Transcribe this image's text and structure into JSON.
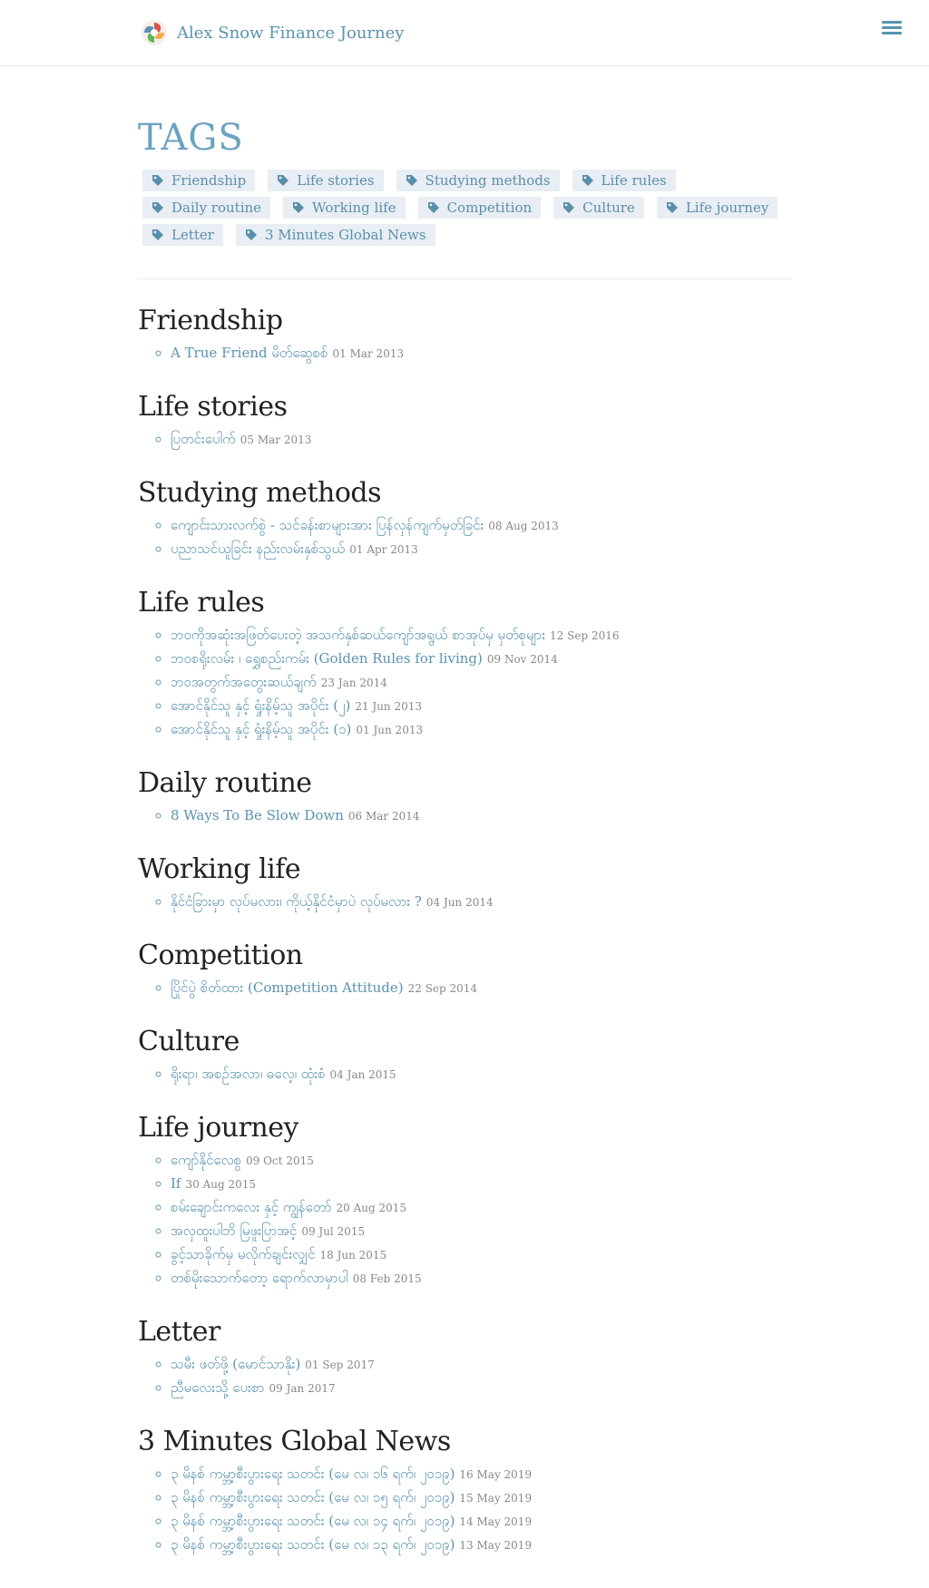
{
  "site": {
    "brand": "Alex Snow Finance Journey"
  },
  "page": {
    "title": "TAGS"
  },
  "tags": [
    "Friendship",
    "Life stories",
    "Studying methods",
    "Life rules",
    "Daily routine",
    "Working life",
    "Competition",
    "Culture",
    "Life journey",
    "Letter",
    "3 Minutes Global News"
  ],
  "sections": [
    {
      "title": "Friendship",
      "posts": [
        {
          "title": "A True Friend မိတ်ဆွေစစ်",
          "date": "01 Mar 2013"
        }
      ]
    },
    {
      "title": "Life stories",
      "posts": [
        {
          "title": "ပြတင်းပေါက်",
          "date": "05 Mar 2013"
        }
      ]
    },
    {
      "title": "Studying methods",
      "posts": [
        {
          "title": "ကျောင်းသားလက်စွဲ - သင်ခန်းစာများအား ပြန်လှန်ကျက်မှတ်ခြင်း",
          "date": "08 Aug 2013"
        },
        {
          "title": "ပညာသင်ယူခြင်း နည်းလမ်းနှစ်သွယ်",
          "date": "01 Apr 2013"
        }
      ]
    },
    {
      "title": "Life rules",
      "posts": [
        {
          "title": "ဘဝကိုအဆုံးအဖြတ်ပေးတဲ့ အသက်နှစ်ဆယ်ကျော်အရွယ် စာအုပ်မှ မှတ်စုများ",
          "date": "12 Sep 2016"
        },
        {
          "title": "ဘဝစရိုးလမ်း ၊ ရွှေစည်းကမ်း (Golden Rules for living)",
          "date": "09 Nov 2014"
        },
        {
          "title": "ဘဝအတွက်အတွေးဆယ်ချက်",
          "date": "23 Jan 2014"
        },
        {
          "title": "အောင်နိုင်သူ နှင့် ရှုံးနိမ့်သူ အပိုင်း (၂)",
          "date": "21 Jun 2013"
        },
        {
          "title": "အောင်နိုင်သူ နှင့် ရှုံးနိမ့်သူ အပိုင်း (၁)",
          "date": "01 Jun 2013"
        }
      ]
    },
    {
      "title": "Daily routine",
      "posts": [
        {
          "title": "8 Ways To Be Slow Down",
          "date": "06 Mar 2014"
        }
      ]
    },
    {
      "title": "Working life",
      "posts": [
        {
          "title": "နိုင်ငံခြားမှာ လုပ်မလား၊ ကိုယ့်နိုင်ငံမှာပဲ လုပ်မလား ?",
          "date": "04 Jun 2014"
        }
      ]
    },
    {
      "title": "Competition",
      "posts": [
        {
          "title": "ပြိုင်ပွဲ စိတ်ထား (Competition Attitude)",
          "date": "22 Sep 2014"
        }
      ]
    },
    {
      "title": "Culture",
      "posts": [
        {
          "title": "ရိုးရာ၊ အစဉ်အလာ၊ ဓလေ့၊ ထုံးစံ",
          "date": "04 Jan 2015"
        }
      ]
    },
    {
      "title": "Life journey",
      "posts": [
        {
          "title": "ကျော်နိုင်လေစွ",
          "date": "09 Oct 2015"
        },
        {
          "title": "If",
          "date": "30 Aug 2015"
        },
        {
          "title": "စမ်းချောင်းကလေး နှင့် ကျွန်တော်",
          "date": "20 Aug 2015"
        },
        {
          "title": "အလှထူးပါဘိ မြဖူးပြာအင့်",
          "date": "09 Jul 2015"
        },
        {
          "title": "ခွင့်သာခိုက်မှ မလိုက်ချင်းလျှင်",
          "date": "18 Jun 2015"
        },
        {
          "title": "တစ်မိုးသောက်တော့ ရောက်လာမှာပါ",
          "date": "08 Feb 2015"
        }
      ]
    },
    {
      "title": "Letter",
      "posts": [
        {
          "title": "သမီး ဖတ်ဖို့ (မောင်သာနိုး)",
          "date": "01 Sep 2017"
        },
        {
          "title": "ညီမလေးသို့ ပေးစာ",
          "date": "09 Jan 2017"
        }
      ]
    },
    {
      "title": "3 Minutes Global News",
      "posts": [
        {
          "title": "၃ မိနစ် ကမ္ဘာ့စီးပွားရေး သတင်း (မေ လ၊ ၁၆ ရက်၊ ၂၀၁၉)",
          "date": "16 May 2019"
        },
        {
          "title": "၃ မိနစ် ကမ္ဘာ့စီးပွားရေး သတင်း (မေ လ၊ ၁၅ ရက်၊ ၂၀၁၉)",
          "date": "15 May 2019"
        },
        {
          "title": "၃ မိနစ် ကမ္ဘာ့စီးပွားရေး သတင်း (မေ လ၊ ၁၄ ရက်၊ ၂၀၁၉)",
          "date": "14 May 2019"
        },
        {
          "title": "၃ မိနစ် ကမ္ဘာ့စီးပွားရေး သတင်း (မေ လ၊ ၁၃ ရက်၊ ၂၀၁၉)",
          "date": "13 May 2019"
        }
      ]
    }
  ]
}
